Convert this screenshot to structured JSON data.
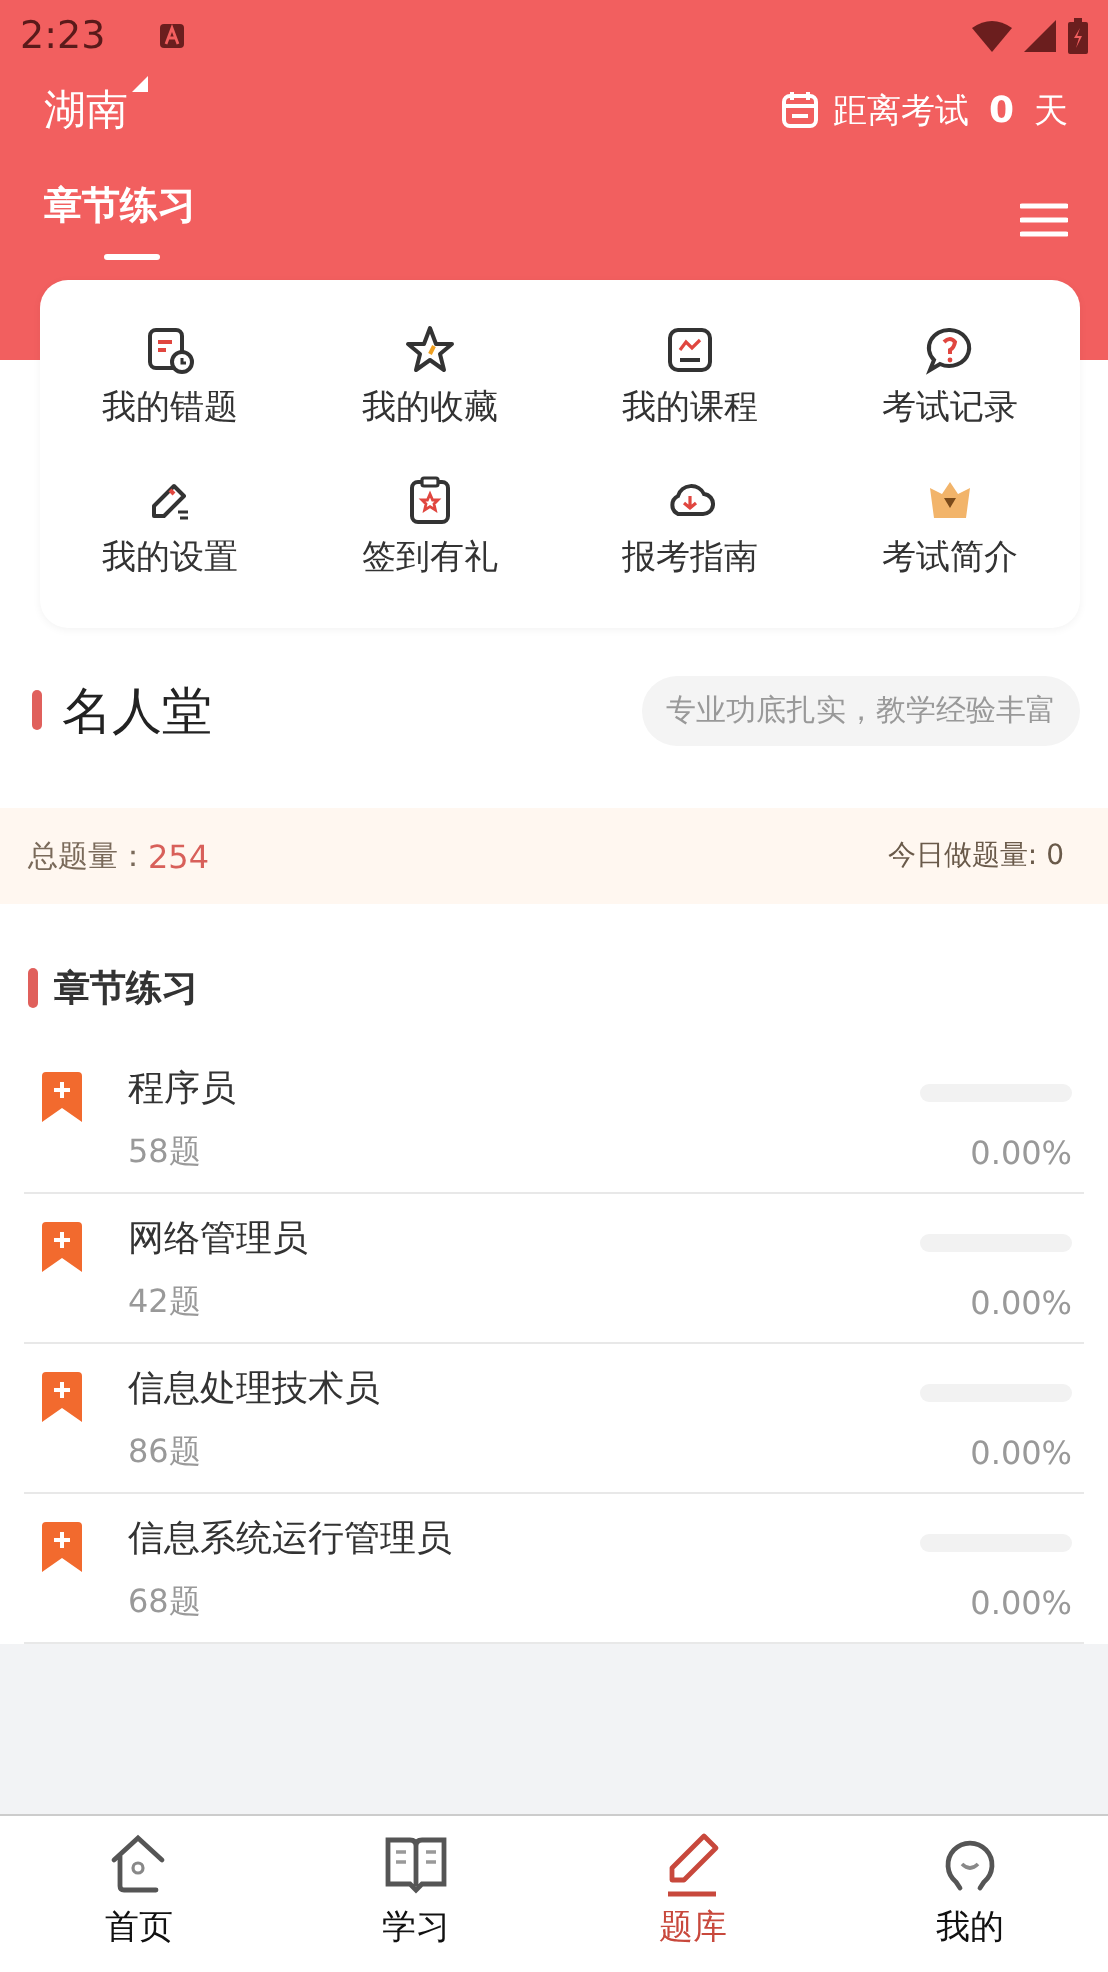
{
  "status_bar": {
    "time": "2:23"
  },
  "header": {
    "region": "湖南",
    "countdown_label": "距离考试",
    "countdown_value": "0",
    "countdown_unit": "天"
  },
  "tabs": [
    {
      "label": "章节练习",
      "selected": true
    }
  ],
  "shortcuts": [
    {
      "label": "我的错题"
    },
    {
      "label": "我的收藏"
    },
    {
      "label": "我的课程"
    },
    {
      "label": "考试记录"
    },
    {
      "label": "我的设置"
    },
    {
      "label": "签到有礼"
    },
    {
      "label": "报考指南"
    },
    {
      "label": "考试简介"
    }
  ],
  "hall_of_fame": {
    "title": "名人堂",
    "tagline": "专业功底扎实，教学经验丰富"
  },
  "stats": {
    "total_label": "总题量：",
    "total_value": "254",
    "today": "今日做题量: 0"
  },
  "section": {
    "title": "章节练习"
  },
  "chapters": [
    {
      "name": "程序员",
      "count": "58题",
      "level": 0,
      "percent": "0.00%"
    },
    {
      "name": "网络管理员",
      "count": "42题",
      "level": 0,
      "percent": "0.00%"
    },
    {
      "name": "信息处理技术员",
      "count": "86题",
      "level": 0,
      "percent": "0.00%"
    },
    {
      "name": "信息系统运行管理员",
      "count": "68题",
      "level": 0,
      "percent": "0.00%"
    }
  ],
  "bottom_nav": [
    {
      "label": "首页",
      "selected": false
    },
    {
      "label": "学习",
      "selected": false
    },
    {
      "label": "题库",
      "selected": true
    },
    {
      "label": "我的",
      "selected": false
    }
  ]
}
